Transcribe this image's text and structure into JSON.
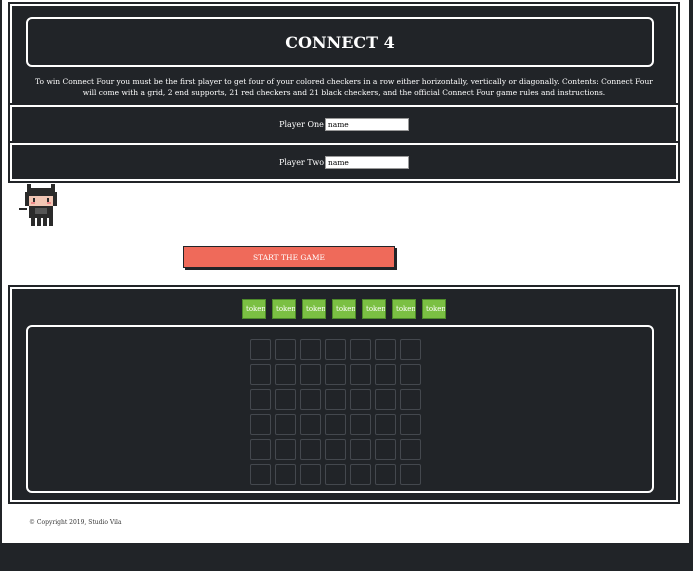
{
  "header": {
    "title": "CONNECT 4",
    "description": "To win Connect Four you must be the first player to get four of your colored checkers in a row either horizontally, vertically or diagonally. Contents: Connect Four will come with a grid, 2 end supports, 21 red checkers and 21 black checkers, and the official Connect Four game rules and instructions."
  },
  "player_one": {
    "label": "Player One",
    "value": "name"
  },
  "player_two": {
    "label": "Player Two",
    "value": "name"
  },
  "start_button": {
    "label": "START THE GAME"
  },
  "tokens": [
    "token",
    "token",
    "token",
    "token",
    "token",
    "token",
    "token"
  ],
  "board": {
    "rows": 6,
    "columns": 7
  },
  "footer": {
    "copyright": "© Copyright 2019, Studio Vila"
  },
  "colors": {
    "background": "#212428",
    "start_button": "#ef6a5a",
    "token": "#7bc043"
  },
  "icons": {
    "mascot": "octocat-pixel-icon"
  }
}
